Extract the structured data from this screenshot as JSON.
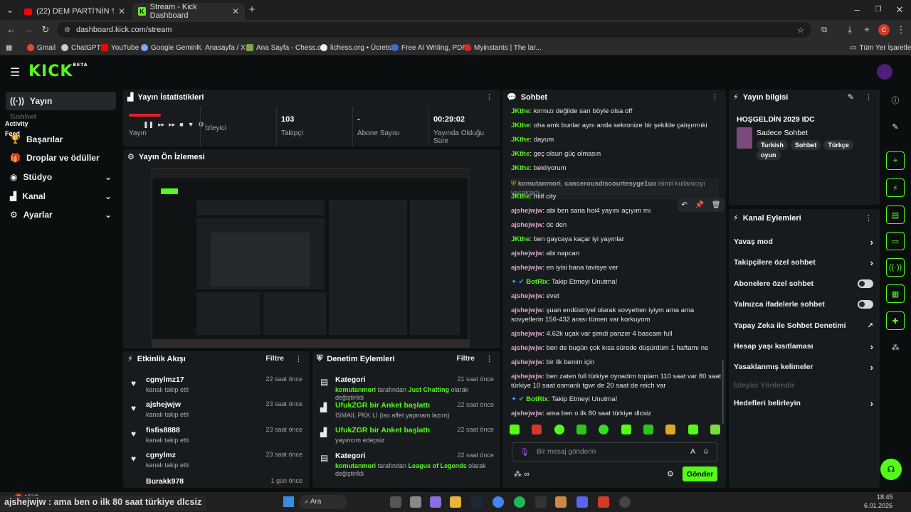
{
  "browser": {
    "tabs": [
      {
        "title": "(22) DEM PARTİ'NİN %60 OY AL"
      },
      {
        "title": "Stream - Kick Dashboard"
      }
    ],
    "url": "dashboard.kick.com/stream",
    "profile_initial": "C",
    "bookmarks": [
      "Gmail",
      "ChatGPT",
      "YouTube",
      "Google Gemini",
      "Anasayfa / X",
      "Ana Sayfa - Chess.c...",
      "lichess.org • Ücretsi...",
      "Free AI Writing, PDF...",
      "Myinstants | The lar..."
    ],
    "all_bookmarks": "Tüm Yer İşaretleri"
  },
  "logo": {
    "text": "KICK",
    "badge": "BETA"
  },
  "sidebar": {
    "items": [
      {
        "label": "Yayın"
      },
      {
        "label": "Başarılar"
      },
      {
        "label": "Droplar ve ödüller"
      },
      {
        "label": "Stüdyo"
      },
      {
        "label": "Kanal"
      },
      {
        "label": "Ayarlar"
      }
    ],
    "tooltip": "Activity Feed",
    "hidden_label": "Sohbet"
  },
  "stats": {
    "title": "Yayın İstatistikleri",
    "items": [
      {
        "value": "",
        "label": "Yayın"
      },
      {
        "value": "",
        "label": "İzleyici"
      },
      {
        "value": "103",
        "label": "Takipçi"
      },
      {
        "value": "-",
        "label": "Abone Sayısı"
      },
      {
        "value": "00:29:02",
        "label": "Yayında Olduğu Süre"
      }
    ]
  },
  "preview": {
    "title": "Yayın Ön İzlemesi"
  },
  "activity": {
    "title": "Etkinlik Akışı",
    "filter": "Filtre",
    "items": [
      {
        "name": "cgnylmz17",
        "sub": "kanalı takip etti",
        "time": "22 saat önce"
      },
      {
        "name": "ajshejwjw",
        "sub": "kanalı takip etti",
        "time": "23 saat önce"
      },
      {
        "name": "fisfis8888",
        "sub": "kanalı takip etti",
        "time": "23 saat önce"
      },
      {
        "name": "cgnylmz",
        "sub": "kanalı takip etti",
        "time": "23 saat önce"
      },
      {
        "name": "Burakk978",
        "sub": "",
        "time": "1 gün önce"
      }
    ]
  },
  "moderation": {
    "title": "Denetim Eylemleri",
    "filter": "Filtre",
    "items": [
      {
        "name": "Kategori",
        "user": "komutanmori",
        "mid": " tarafından ",
        "target": "Just Chatting",
        "end": " olarak değiştirildi",
        "time": "21 saat önce"
      },
      {
        "name": "UfukZGR bir Anket başlattı",
        "sub": "İSMAİL PKK Lİ (iso affet yapmam lazım)",
        "time": "22 saat önce"
      },
      {
        "name": "UfukZGR bir Anket başlattı",
        "sub": "yayıncım edepsiz",
        "time": "22 saat önce"
      },
      {
        "name": "Kategori",
        "user": "komutanmori",
        "mid": " tarafından ",
        "target": "League of Legends",
        "end": " olarak değiştirildi",
        "time": "22 saat önce"
      }
    ]
  },
  "chat": {
    "title": "Sohbet",
    "messages": [
      {
        "user": "JKthe",
        "text": "kırmızı değilde sarı böyle olsa off"
      },
      {
        "user": "JKthe",
        "text": "oha amk bunlar aynı anda sekronize bir şekilde çalışırmıki"
      },
      {
        "user": "JKthe",
        "text": "dayum"
      },
      {
        "user": "JKthe",
        "text": "geç olsun güç olmasın"
      },
      {
        "user": "JKthe",
        "text": "bekliyorum"
      },
      {
        "user": "komutanmori",
        "text": "cancerousdiscourtesyge1uo",
        "system": "isimli kullanıcıyı yasakladı"
      },
      {
        "user": "JKthe",
        "text": "milf city"
      },
      {
        "user": "ajshejwjw",
        "text": "abi ben sana hoi4 yayını açıyım mı"
      },
      {
        "user": "ajshejwjw",
        "text": "dc den"
      },
      {
        "user": "JKthe",
        "text": "ben gaycaya kaçar iyi yayınlar"
      },
      {
        "user": "ajshejwjw",
        "text": "abi napcan"
      },
      {
        "user": "ajshejwjw",
        "text": "en iyisi bana tavisye ver"
      },
      {
        "user": "BotRix",
        "text": "Takip Etmeyi Unutma!"
      },
      {
        "user": "ajshejwjw",
        "text": "evet"
      },
      {
        "user": "ajshejwjw",
        "text": "şuan endüstriyel olarak sovyetten iyiym ama ama sovyetlerin 156-432 arası tümen var korkuyom"
      },
      {
        "user": "ajshejwjw",
        "text": "4.62k uçak var şimdi panzer 4 bascam full"
      },
      {
        "user": "ajshejwjw",
        "text": "ben de bugün çok kısa sürede düşürdüm 1 haftamı ne"
      },
      {
        "user": "ajshejwjw",
        "text": "bir ilk benim için"
      },
      {
        "user": "ajshejwjw",
        "text": "ben zaten full türkiye oynadım toplam 110 saat var 80 saat türkiye 10 saat osmanlı tgwr de 20 saat de reich var"
      },
      {
        "user": "BotRix",
        "text": "Takip Etmeyi Unutma!"
      },
      {
        "user": "ajshejwjw",
        "text": "ama ben o ilk 80 saat türkiye dlcsiz"
      }
    ],
    "placeholder": "Bir mesaj gönderin",
    "send_label": "Gönder"
  },
  "stream_info": {
    "title": "Yayın bilgisi",
    "stream_title": "HOŞGELDİN 2029 IDC",
    "category": "Sadece Sohbet",
    "tags": [
      "Turkish",
      "Sohbet",
      "Türkçe",
      "oyun"
    ]
  },
  "channel_actions": {
    "title": "Kanal Eylemleri",
    "items": [
      {
        "label": "Yavaş mod",
        "type": "arrow"
      },
      {
        "label": "Takipçilere özel sohbet",
        "type": "arrow"
      },
      {
        "label": "Abonelere özel sohbet",
        "type": "toggle"
      },
      {
        "label": "Yalnızca ifadelerle sohbet",
        "type": "toggle"
      },
      {
        "label": "Yapay Zeka ile Sohbet Denetimi",
        "type": "external"
      },
      {
        "label": "Hesap yaşı kısıtlaması",
        "type": "arrow"
      },
      {
        "label": "Yasaklanmış kelimeler",
        "type": "arrow"
      },
      {
        "label": "İzleyici Yönlendir",
        "type": "disabled"
      },
      {
        "label": "Hedefleri belirleyin",
        "type": "arrow"
      }
    ]
  },
  "taskbar": {
    "weather": "15°C",
    "badge": "6",
    "search": "Ara",
    "time": "18:45",
    "date": "6.01.2026",
    "caption": "ajshejwjw : ama ben o ilk 80 saat türkiye dlcsiz"
  },
  "colors": {
    "accent": "#53fc18",
    "panel": "#181b1d",
    "bg": "#0b0e0f"
  }
}
